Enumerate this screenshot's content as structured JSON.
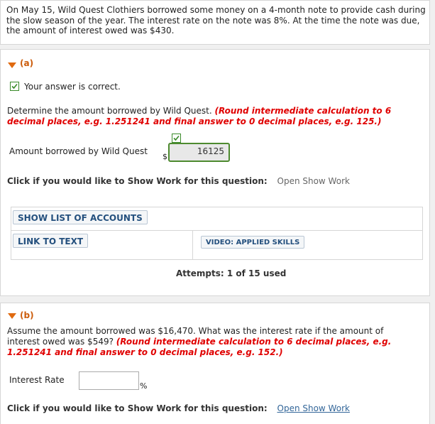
{
  "problem": {
    "text": "On May 15, Wild Quest Clothiers borrowed some money on a 4-month note to provide cash during the slow season of the year. The interest rate on the note was 8%. At the time the note was due, the amount of interest owed was $430."
  },
  "part_a": {
    "label": "(a)",
    "status": "Your answer is correct.",
    "instruction": "Determine the amount borrowed by Wild Quest.",
    "rounding_note": "(Round intermediate calculation to 6 decimal places, e.g. 1.251241 and final answer to 0 decimal places, e.g. 125.)",
    "field_label": "Amount borrowed by Wild Quest",
    "currency": "$",
    "value": "16125",
    "show_work_prompt": "Click if you would like to Show Work for this question:",
    "show_work_link": "Open Show Work",
    "buttons": {
      "show_accounts": "SHOW LIST OF ACCOUNTS",
      "link_to_text": "LINK TO TEXT",
      "video": "VIDEO: APPLIED SKILLS"
    },
    "attempts": "Attempts: 1 of 15 used"
  },
  "part_b": {
    "label": "(b)",
    "instruction": "Assume the amount borrowed was $16,470. What was the interest rate if the amount of interest owed was $549?",
    "rounding_note": "(Round intermediate calculation to 6 decimal places, e.g. 1.251241 and final answer to 0 decimal places, e.g. 152.)",
    "field_label": "Interest Rate",
    "value": "",
    "unit": "%",
    "show_work_prompt": "Click if you would like to Show Work for this question:",
    "show_work_link": "Open Show Work"
  },
  "colors": {
    "accent_orange": "#e06a10",
    "correct_green": "#4d8a2f",
    "note_red": "#e00000",
    "button_text": "#24507e"
  }
}
